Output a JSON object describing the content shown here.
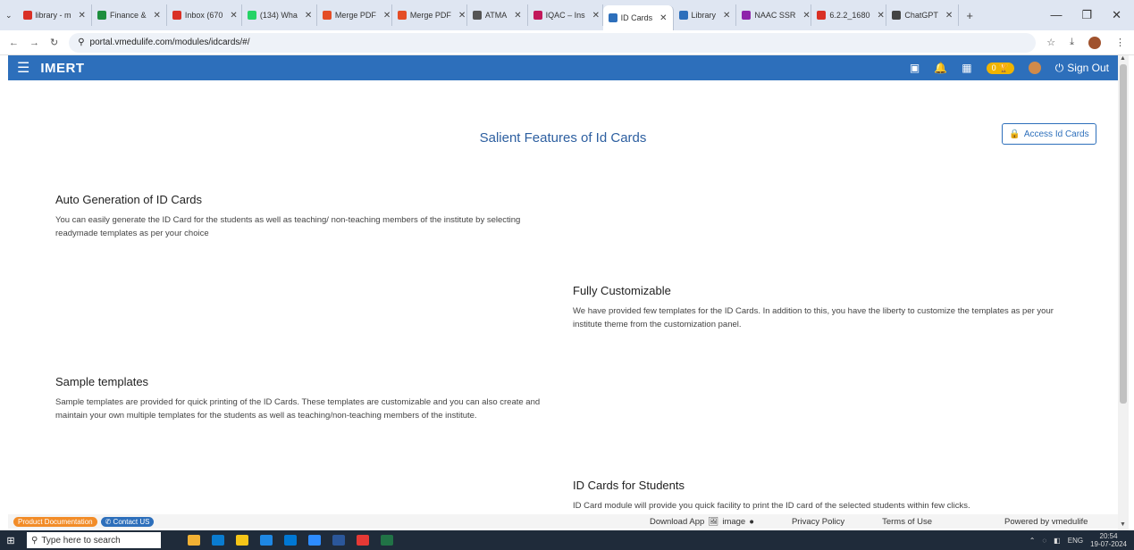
{
  "browser": {
    "tabs": [
      {
        "label": "library - m",
        "color": "#d93025"
      },
      {
        "label": "Finance &",
        "color": "#1e8e3e"
      },
      {
        "label": "Inbox (670",
        "color": "#d93025"
      },
      {
        "label": "(134) Wha",
        "color": "#25d366"
      },
      {
        "label": "Merge PDF",
        "color": "#e44d26"
      },
      {
        "label": "Merge PDF",
        "color": "#e44d26"
      },
      {
        "label": "ATMA",
        "color": "#555555"
      },
      {
        "label": "IQAC – Ins",
        "color": "#c2185b"
      },
      {
        "label": "ID Cards",
        "color": "#2d6fbb",
        "active": true
      },
      {
        "label": "Library",
        "color": "#2d6fbb"
      },
      {
        "label": "NAAC SSR",
        "color": "#8e24aa"
      },
      {
        "label": "6.2.2_1680",
        "color": "#d93025"
      },
      {
        "label": "ChatGPT",
        "color": "#444444"
      }
    ],
    "url": "portal.vmedulife.com/modules/idcards/#/"
  },
  "app": {
    "title": "IMERT",
    "points_badge": "0",
    "sign_out": "Sign Out"
  },
  "content": {
    "page_title": "Salient Features of Id Cards",
    "access_button": "Access Id Cards",
    "features": [
      {
        "title": "Auto Generation of ID Cards",
        "text": "You can easily generate the ID Card for the students as well as teaching/ non-teaching members of the institute by selecting readymade templates as per your choice"
      },
      {
        "title": "Fully Customizable",
        "text": "We have provided few templates for the ID Cards. In addition to this, you have the liberty to customize the templates as per your institute theme from the customization panel."
      },
      {
        "title": "Sample templates",
        "text": "Sample templates are provided for quick printing of the ID Cards. These templates are customizable and you can also create and maintain your own multiple templates for the students as well as teaching/non-teaching members of the institute."
      },
      {
        "title": "ID Cards for Students",
        "text": "ID Card module will provide you quick facility to print the ID card of the selected students within few clicks."
      }
    ]
  },
  "footer": {
    "product_docs": "Product Documentation",
    "contact": "Contact US",
    "download_app": "Download App",
    "image_alt": "image",
    "privacy": "Privacy Policy",
    "terms": "Terms of Use",
    "powered": "Powered by vmedulife"
  },
  "taskbar": {
    "search_placeholder": "Type here to search",
    "lang": "ENG",
    "time": "20:54",
    "date": "19-07-2024",
    "apps": [
      "#f2b134",
      "#0a7cd0",
      "#f5c518",
      "#1e88e5",
      "#0078d4",
      "#2d8cff",
      "#2b579a",
      "#e53935",
      "#217346"
    ]
  }
}
